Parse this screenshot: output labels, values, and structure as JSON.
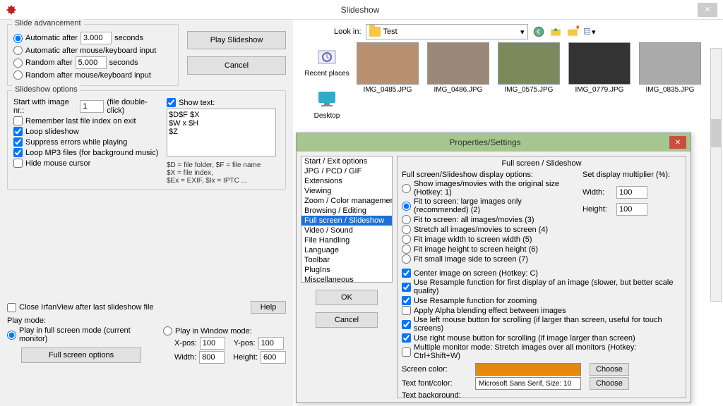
{
  "titlebar": {
    "title": "Slideshow"
  },
  "slide_adv": {
    "title": "Slide advancement",
    "auto_after": "Automatic after",
    "auto_after_val": "3.000",
    "seconds": "seconds",
    "auto_mouse": "Automatic after mouse/keyboard input",
    "random_after": "Random   after",
    "random_after_val": "5.000",
    "random_mouse": "Random   after mouse/keyboard input"
  },
  "buttons": {
    "play": "Play Slideshow",
    "cancel": "Cancel",
    "help": "Help",
    "ok": "OK",
    "choose": "Choose",
    "fullscreen_opts": "Full screen options"
  },
  "options": {
    "title": "Slideshow options",
    "start_with": "Start with image nr.:",
    "start_val": "1",
    "start_hint": "(file double-click)",
    "remember": "Remember last file index on exit",
    "loop": "Loop slideshow",
    "suppress": "Suppress errors while playing",
    "loop_mp3": "Loop MP3 files (for background music)",
    "hide_cursor": "Hide mouse cursor",
    "show_text": "Show text:",
    "text_val": "$D$F $X\n$W x $H\n$Z",
    "legend": "$D = file folder, $F = file name\n$X = file index,\n$Ex = EXIF, $Ix = IPTC ...",
    "close_after": "Close IrfanView after last slideshow file"
  },
  "playmode": {
    "title": "Play mode:",
    "fullscreen": "Play in full screen mode (current monitor)",
    "window": "Play in Window mode:",
    "xpos_l": "X-pos:",
    "xpos": "100",
    "ypos_l": "Y-pos:",
    "ypos": "100",
    "width_l": "Width:",
    "width": "800",
    "height_l": "Height:",
    "height": "600"
  },
  "browser": {
    "lookin": "Look in:",
    "folder": "Test",
    "places": {
      "recent": "Recent places",
      "desktop": "Desktop"
    },
    "files": [
      "IMG_0485.JPG",
      "IMG_0486.JPG",
      "IMG_0575.JPG",
      "IMG_0779.JPG",
      "IMG_0835.JPG"
    ]
  },
  "props": {
    "title": "Properties/Settings",
    "nav": [
      "Start / Exit options",
      "JPG / PCD / GIF",
      "Extensions",
      "Viewing",
      "Zoom / Color management",
      "Browsing / Editing",
      "Full screen / Slideshow",
      "Video / Sound",
      "File Handling",
      "Language",
      "Toolbar",
      "PlugIns",
      "Miscellaneous"
    ],
    "heading": "Full screen / Slideshow",
    "disp_opts_label": "Full screen/Slideshow display options:",
    "multiplier_label": "Set display multiplier (%):",
    "width_l": "Width:",
    "width": "100",
    "height_l": "Height:",
    "height": "100",
    "radios": [
      "Show images/movies with the original size (Hotkey: 1)",
      "Fit to screen: large images only (recommended) (2)",
      "Fit to screen: all images/movies (3)",
      "Stretch all images/movies to screen (4)",
      "Fit image width to screen width (5)",
      "Fit image height to screen height (6)",
      "Fit small image side to screen (7)"
    ],
    "checks": [
      "Center image on screen (Hotkey: C)",
      "Use Resample function for first display of an image (slower, but better scale quality)",
      "Use Resample function for zooming",
      "Apply Alpha blending effect between images",
      "Use left mouse button for scrolling (if larger than screen, useful for touch screens)",
      "Use right mouse button for scrolling (if image larger than screen)",
      "Multiple monitor mode: Stretch images over all monitors (Hotkey: Ctrl+Shift+W)"
    ],
    "check_states": [
      true,
      true,
      true,
      false,
      true,
      true,
      false
    ],
    "screen_color": "Screen color:",
    "font": "Text font/color:",
    "font_val": "Microsoft Sans Serif, Size: 10",
    "text_bg": "Text background:"
  }
}
